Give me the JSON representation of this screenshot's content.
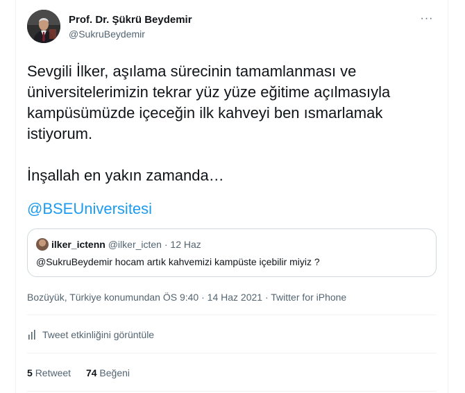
{
  "author": {
    "name": "Prof. Dr. Şükrü Beydemir",
    "handle": "@SukruBeydemir"
  },
  "more_label": "···",
  "tweet": {
    "text": "Sevgili İlker, aşılama sürecinin tamamlanması ve\nüniversitelerimizin tekrar yüz yüze eğitime açılmasıyla\nkampüsümüzde içeceğin ilk kahveyi ben ısmarlamak\nistiyorum.\n\nİnşallah en yakın zamanda…",
    "mention": "@BSEUniversitesi"
  },
  "quote": {
    "name": "ilker_ictenn",
    "handle": "@ilker_icten",
    "separator": "·",
    "date": "12 Haz",
    "text": "@SukruBeydemir hocam artık kahvemizi kampüste içebilir miyiz ?"
  },
  "meta": {
    "location_time": "Bozüyük, Türkiye konumundan ÖS 9:40",
    "separator": "·",
    "date": "14 Haz 2021",
    "source": "Twitter for iPhone"
  },
  "analytics_label": "Tweet etkinliğini görüntüle",
  "stats": {
    "retweet_count": "5",
    "retweet_label": "Retweet",
    "like_count": "74",
    "like_label": "Beğeni"
  },
  "colors": {
    "link": "#1d9bf0",
    "text": "#0f1419",
    "muted": "#536471",
    "border": "#cfd9de"
  },
  "icons": {
    "more": "more-icon",
    "analytics": "analytics-icon"
  }
}
